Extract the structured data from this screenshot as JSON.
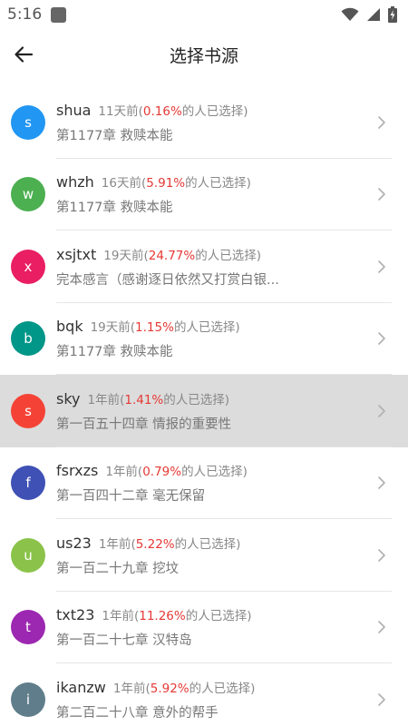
{
  "status": {
    "time": "5:16"
  },
  "header": {
    "title": "选择书源"
  },
  "sources": [
    {
      "letter": "s",
      "name": "shua",
      "time": "11天前",
      "pct": "0.16%",
      "chapter": "第1177章 救赎本能",
      "color": "#2196f3"
    },
    {
      "letter": "w",
      "name": "whzh",
      "time": "16天前",
      "pct": "5.91%",
      "chapter": "第1177章 救赎本能",
      "color": "#4caf50"
    },
    {
      "letter": "x",
      "name": "xsjtxt",
      "time": "19天前",
      "pct": "24.77%",
      "chapter": "完本感言（感谢逐日依然又打赏白银...",
      "color": "#e91e63"
    },
    {
      "letter": "b",
      "name": "bqk",
      "time": "19天前",
      "pct": "1.15%",
      "chapter": "第1177章 救赎本能",
      "color": "#009688"
    },
    {
      "letter": "s",
      "name": "sky",
      "time": "1年前",
      "pct": "1.41%",
      "chapter": "第一百五十四章 情报的重要性",
      "color": "#f44336",
      "selected": true
    },
    {
      "letter": "f",
      "name": "fsrxzs",
      "time": "1年前",
      "pct": "0.79%",
      "chapter": "第一百四十二章 毫无保留",
      "color": "#3f51b5"
    },
    {
      "letter": "u",
      "name": "us23",
      "time": "1年前",
      "pct": "5.22%",
      "chapter": "第一百二十九章 挖坟",
      "color": "#8bc34a"
    },
    {
      "letter": "t",
      "name": "txt23",
      "time": "1年前",
      "pct": "11.26%",
      "chapter": "第一百二十七章 汉特岛",
      "color": "#9c27b0"
    },
    {
      "letter": "i",
      "name": "ikanzw",
      "time": "1年前",
      "pct": "5.92%",
      "chapter": "第二百二十八章 意外的帮手",
      "color": "#607d8b"
    }
  ],
  "labels": {
    "open_paren": "(",
    "suffix": "的人已选择)"
  },
  "icons": {
    "back": "arrow-left-icon",
    "chevron": "chevron-right-icon",
    "wifi": "wifi-icon",
    "signal": "signal-icon",
    "battery": "battery-charging-icon"
  }
}
